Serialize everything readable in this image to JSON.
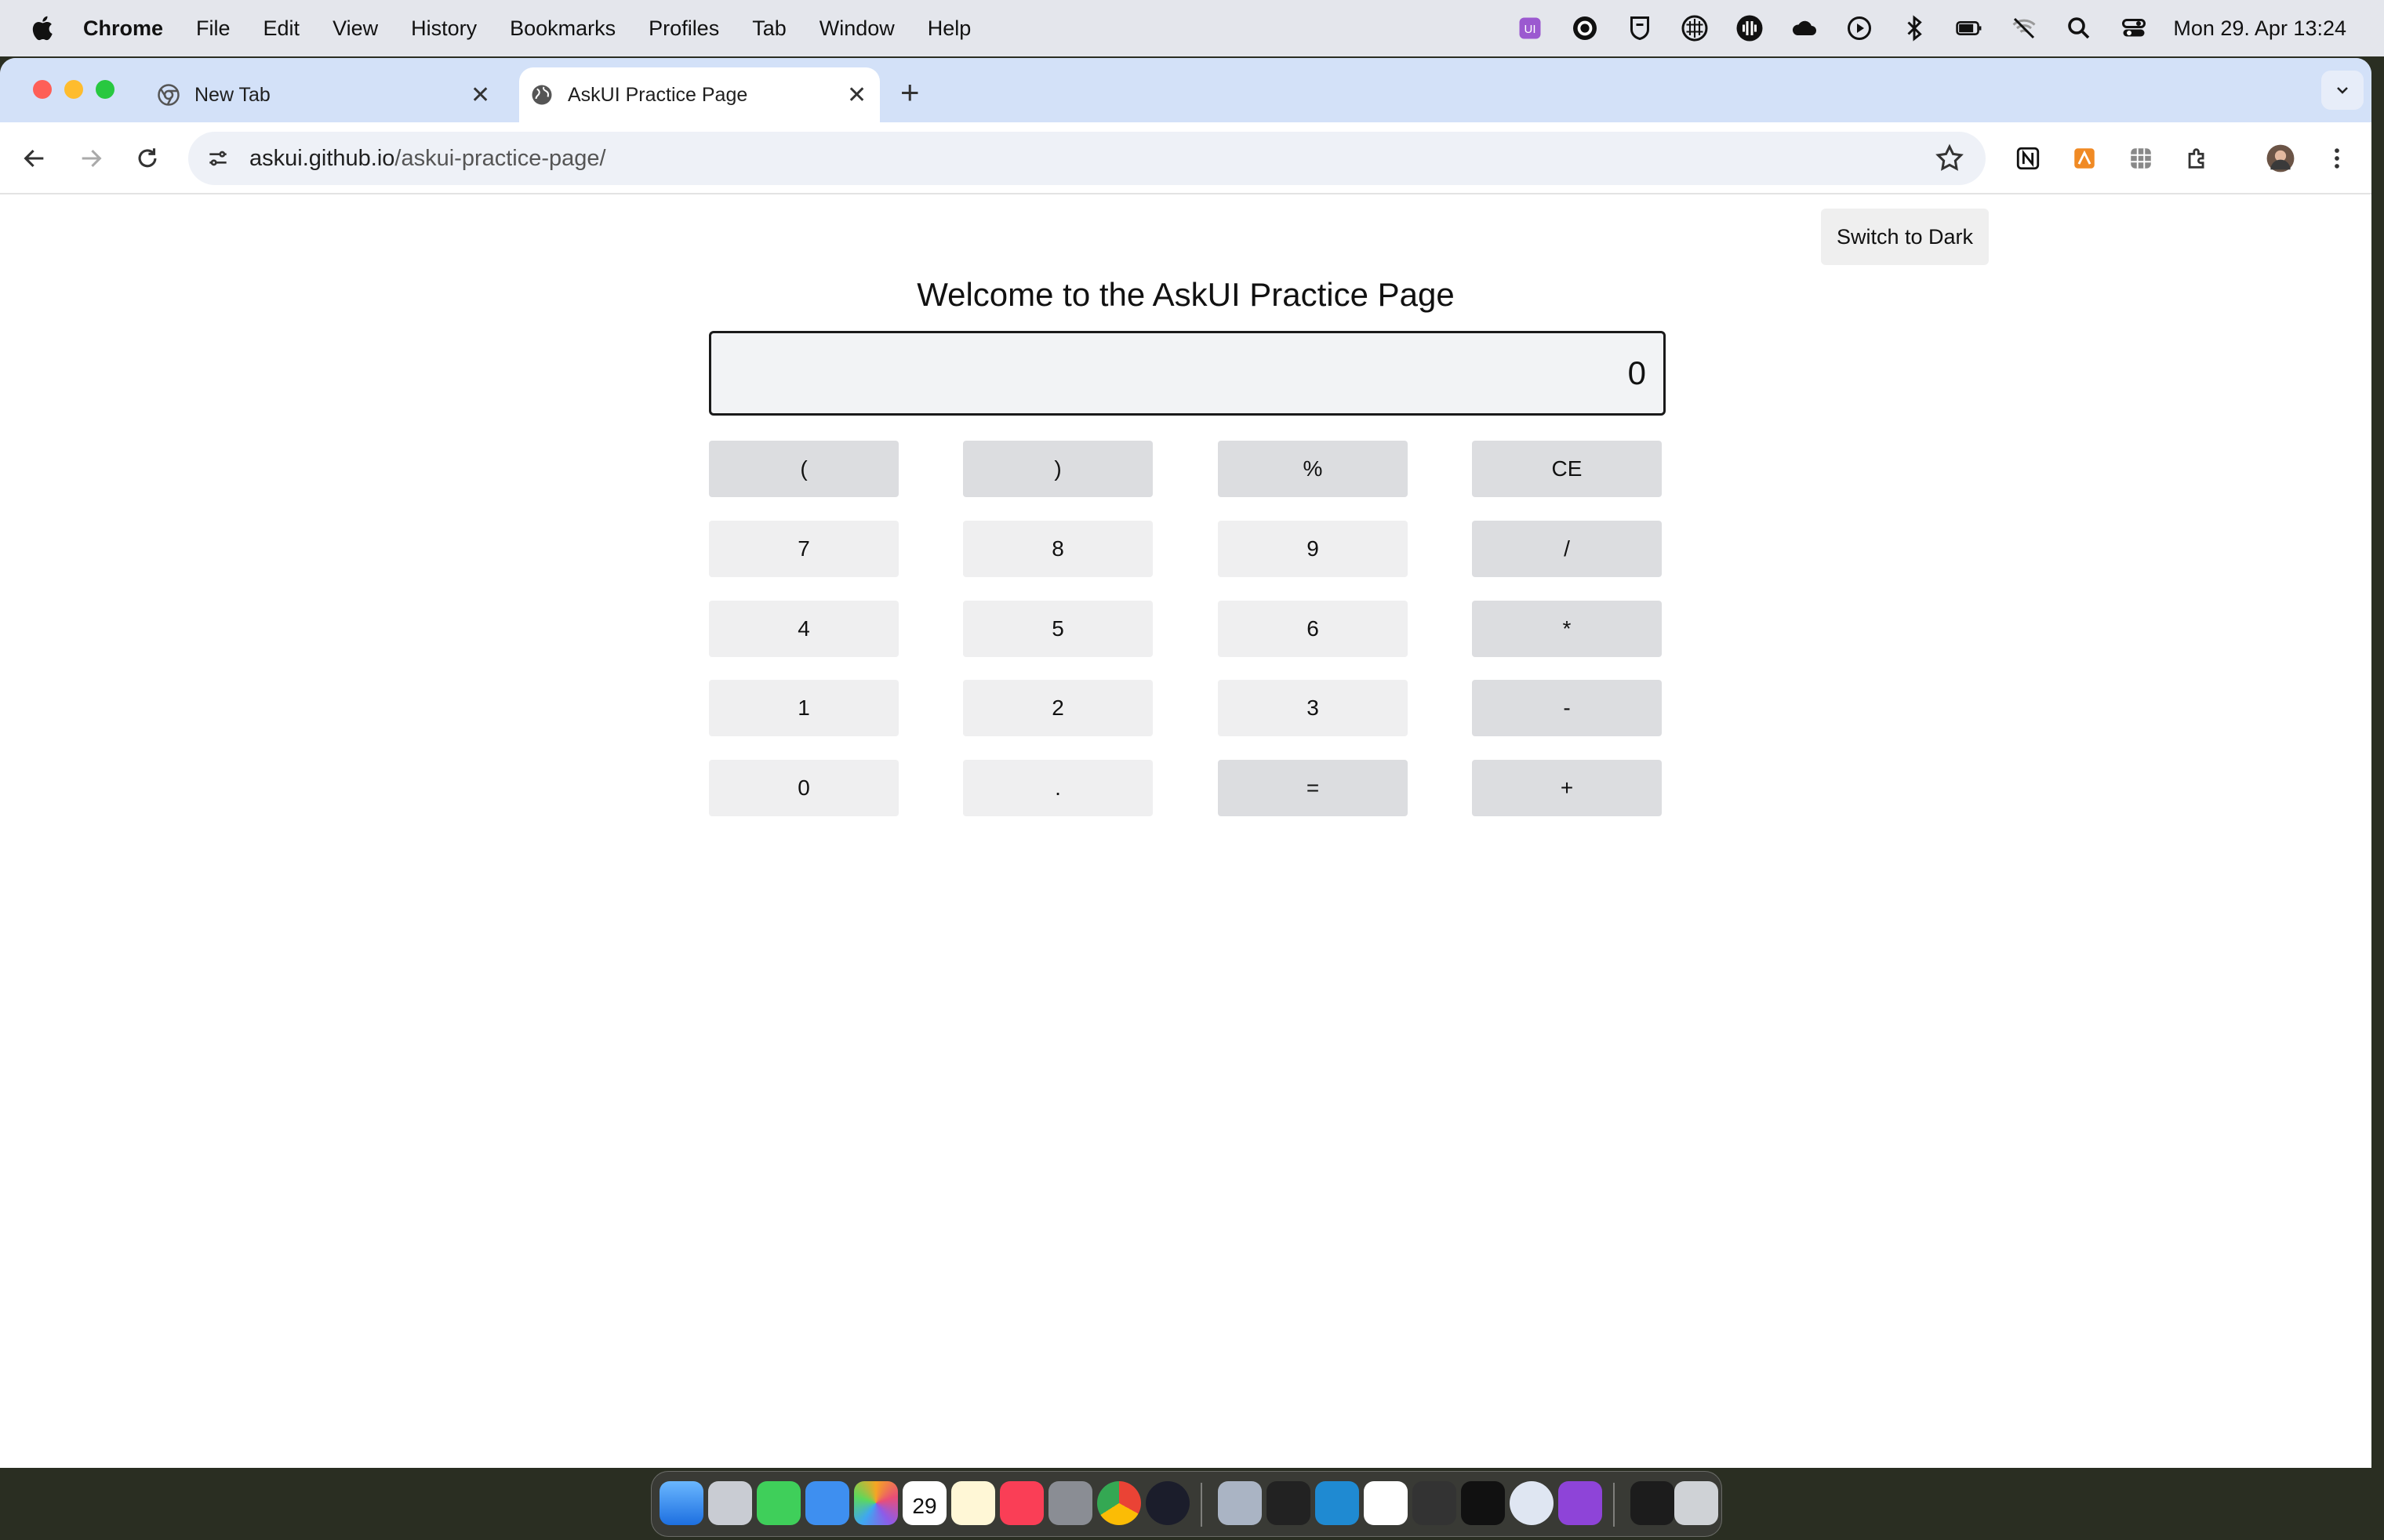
{
  "menubar": {
    "items": [
      "Chrome",
      "File",
      "Edit",
      "View",
      "History",
      "Bookmarks",
      "Profiles",
      "Tab",
      "Window",
      "Help"
    ],
    "clock": "Mon 29. Apr  13:24"
  },
  "browser": {
    "tabs": [
      {
        "title": "New Tab"
      },
      {
        "title": "AskUI Practice Page"
      }
    ],
    "url_host": "askui.github.io",
    "url_path": "/askui-practice-page/"
  },
  "page": {
    "theme_button": "Switch to Dark",
    "heading": "Welcome to the AskUI Practice Page",
    "display_value": "0",
    "keys": [
      "(",
      ")",
      "%",
      "CE",
      "7",
      "8",
      "9",
      "/",
      "4",
      "5",
      "6",
      "*",
      "1",
      "2",
      "3",
      "-",
      "0",
      ".",
      "=",
      "+"
    ]
  },
  "dock": {
    "calendar_day": "29"
  },
  "colors": {
    "tab_strip": "#d3e1f8",
    "display_border": "#1a1a1a",
    "key_bg": "#efeff0",
    "operator_key_bg": "#dcdde0"
  }
}
